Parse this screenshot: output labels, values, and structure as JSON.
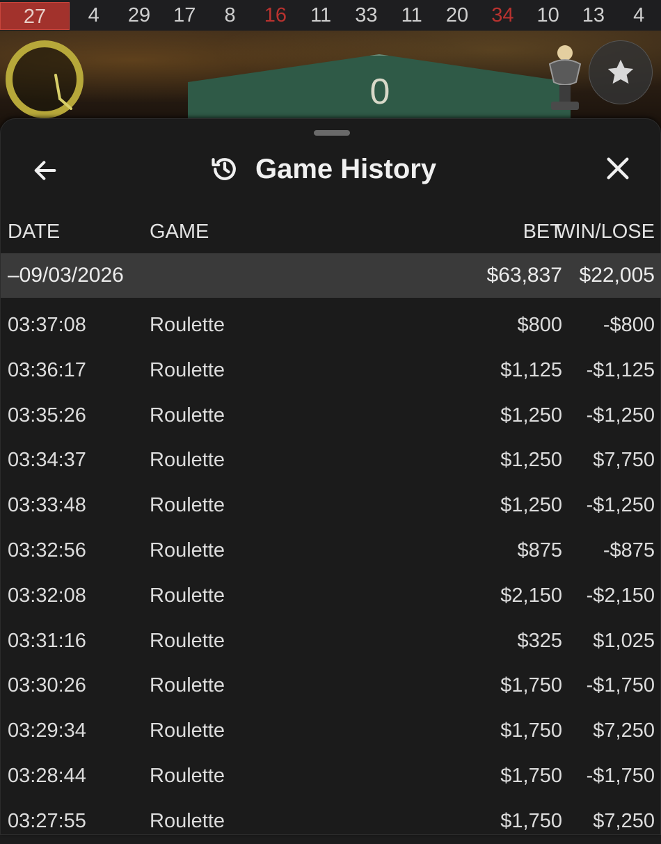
{
  "results_strip": [
    {
      "value": "27",
      "color": "latest"
    },
    {
      "value": "4",
      "color": "black"
    },
    {
      "value": "29",
      "color": "black"
    },
    {
      "value": "17",
      "color": "black"
    },
    {
      "value": "8",
      "color": "black"
    },
    {
      "value": "16",
      "color": "red"
    },
    {
      "value": "11",
      "color": "black"
    },
    {
      "value": "33",
      "color": "black"
    },
    {
      "value": "11",
      "color": "black"
    },
    {
      "value": "20",
      "color": "black"
    },
    {
      "value": "34",
      "color": "red"
    },
    {
      "value": "10",
      "color": "black"
    },
    {
      "value": "13",
      "color": "black"
    },
    {
      "value": "4",
      "color": "black"
    }
  ],
  "scene": {
    "zero_label": "0"
  },
  "panel": {
    "title": "Game History",
    "back_icon": "arrow-left-icon",
    "close_icon": "close-icon",
    "title_icon": "history-icon",
    "columns": {
      "date": "DATE",
      "game": "GAME",
      "bet": "BET",
      "win_lose": "WIN/LOSE"
    },
    "day_summary": {
      "date": "–09/03/2026",
      "bet": "$63,837",
      "win_lose": "$22,005"
    },
    "rows": [
      {
        "time": "03:37:08",
        "game": "Roulette",
        "bet": "$800",
        "win_lose": "-$800"
      },
      {
        "time": "03:36:17",
        "game": "Roulette",
        "bet": "$1,125",
        "win_lose": "-$1,125"
      },
      {
        "time": "03:35:26",
        "game": "Roulette",
        "bet": "$1,250",
        "win_lose": "-$1,250"
      },
      {
        "time": "03:34:37",
        "game": "Roulette",
        "bet": "$1,250",
        "win_lose": "$7,750"
      },
      {
        "time": "03:33:48",
        "game": "Roulette",
        "bet": "$1,250",
        "win_lose": "-$1,250"
      },
      {
        "time": "03:32:56",
        "game": "Roulette",
        "bet": "$875",
        "win_lose": "-$875"
      },
      {
        "time": "03:32:08",
        "game": "Roulette",
        "bet": "$2,150",
        "win_lose": "-$2,150"
      },
      {
        "time": "03:31:16",
        "game": "Roulette",
        "bet": "$325",
        "win_lose": "$1,025"
      },
      {
        "time": "03:30:26",
        "game": "Roulette",
        "bet": "$1,750",
        "win_lose": "-$1,750"
      },
      {
        "time": "03:29:34",
        "game": "Roulette",
        "bet": "$1,750",
        "win_lose": "$7,250"
      },
      {
        "time": "03:28:44",
        "game": "Roulette",
        "bet": "$1,750",
        "win_lose": "-$1,750"
      },
      {
        "time": "03:27:55",
        "game": "Roulette",
        "bet": "$1,750",
        "win_lose": "$7,250"
      }
    ]
  }
}
